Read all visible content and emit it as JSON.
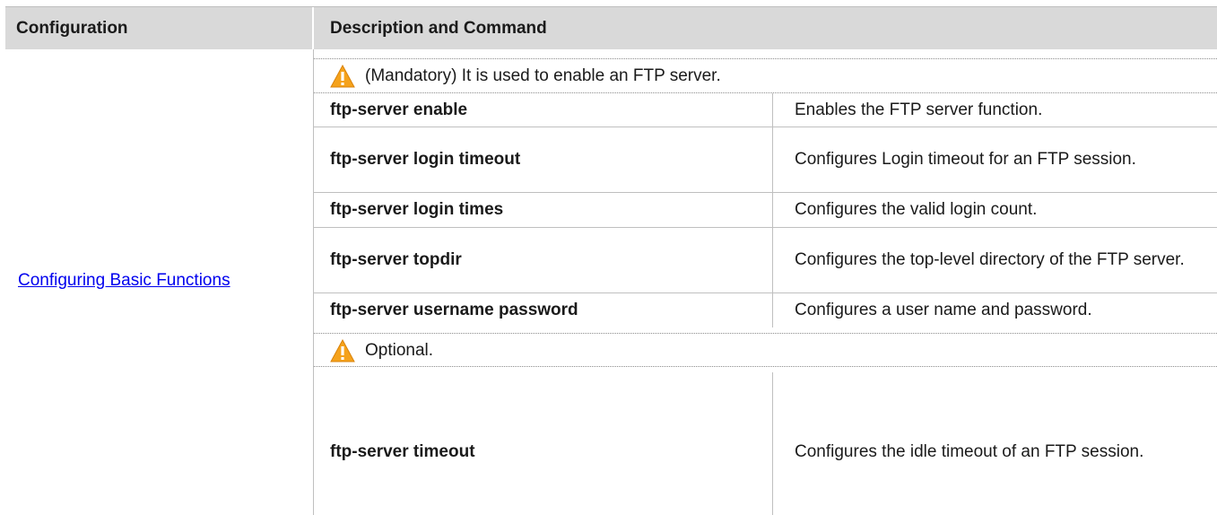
{
  "table": {
    "headers": {
      "configuration": "Configuration",
      "description": "Description and Command"
    },
    "section_link": "Configuring Basic Functions",
    "mandatory_note": "(Mandatory) It is used to enable an FTP server.",
    "optional_note": "Optional.",
    "mandatory_commands": [
      {
        "command": "ftp-server enable",
        "description": "Enables the FTP server function."
      },
      {
        "command": "ftp-server login timeout",
        "description": "Configures Login timeout for an FTP session."
      },
      {
        "command": "ftp-server login times",
        "description": "Configures the valid login count."
      },
      {
        "command": "ftp-server topdir",
        "description": "Configures the top-level directory of the FTP server."
      },
      {
        "command": "ftp-server username password",
        "description": "Configures a user name and password."
      }
    ],
    "optional_commands": [
      {
        "command": "ftp-server timeout",
        "description": "Configures the idle timeout of an FTP session."
      }
    ]
  },
  "icons": {
    "warning": "warning-icon"
  },
  "colors": {
    "header_bg": "#d9d9d9",
    "link": "#0000ee",
    "warning_orange": "#f5a21b"
  }
}
